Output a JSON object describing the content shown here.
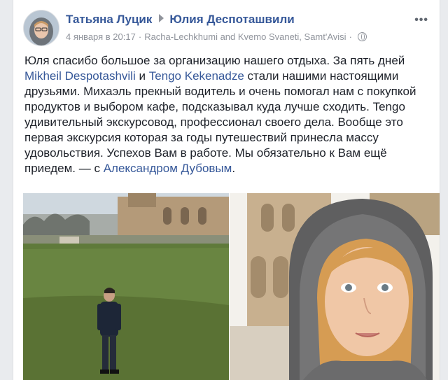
{
  "post": {
    "author": "Татьяна Луцик",
    "recipient": "Юлия Деспоташвили",
    "date": "4 января в 20:17",
    "location": "Racha-Lechkhumi and Kvemo Svaneti, Samt'Avisi",
    "separator": "·",
    "more_label": "•••",
    "text": {
      "part1": "Юля спасибо большое за организацию нашего отдыха. За пять дней ",
      "mention1": "Mikheil Despotashvili",
      "part2": " и ",
      "mention2": "Tengo Kekenadze",
      "part3": " стали нашими настоящими друзьями. Михаэль прекный водитель и очень помогал нам с покупкой продуктов и выбором кафе, подсказывал куда лучше сходить. Tengo удивительный экскурсовод, профессионал своего дела. Вообще это первая экскурсия которая за годы путешествий принесла массу удовольствия. Успехов Вам в работе. Мы обязательно к Вам ещё приедем. — с ",
      "mention3": "Александром Дубовым",
      "part4": "."
    }
  },
  "colors": {
    "link": "#365899",
    "meta": "#90949c",
    "text": "#1d2129"
  }
}
